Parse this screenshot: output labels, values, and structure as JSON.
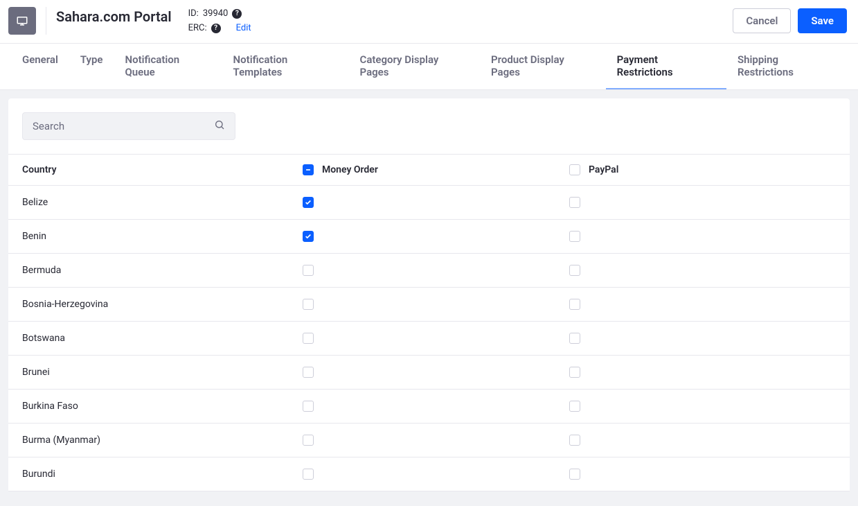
{
  "header": {
    "title": "Sahara.com Portal",
    "id_label": "ID:",
    "id_value": "39940",
    "erc_label": "ERC:",
    "edit": "Edit",
    "cancel": "Cancel",
    "save": "Save"
  },
  "tabs": [
    {
      "label": "General",
      "active": false
    },
    {
      "label": "Type",
      "active": false
    },
    {
      "label": "Notification Queue",
      "active": false
    },
    {
      "label": "Notification Templates",
      "active": false
    },
    {
      "label": "Category Display Pages",
      "active": false
    },
    {
      "label": "Product Display Pages",
      "active": false
    },
    {
      "label": "Payment Restrictions",
      "active": true
    },
    {
      "label": "Shipping Restrictions",
      "active": false
    }
  ],
  "search": {
    "placeholder": "Search"
  },
  "table": {
    "country_header": "Country",
    "columns": [
      {
        "label": "Money Order",
        "state": "indeterminate"
      },
      {
        "label": "PayPal",
        "state": "unchecked"
      }
    ],
    "rows": [
      {
        "country": "Belize",
        "cells": [
          "checked",
          "unchecked"
        ]
      },
      {
        "country": "Benin",
        "cells": [
          "checked",
          "unchecked"
        ]
      },
      {
        "country": "Bermuda",
        "cells": [
          "unchecked",
          "unchecked"
        ]
      },
      {
        "country": "Bosnia-Herzegovina",
        "cells": [
          "unchecked",
          "unchecked"
        ]
      },
      {
        "country": "Botswana",
        "cells": [
          "unchecked",
          "unchecked"
        ]
      },
      {
        "country": "Brunei",
        "cells": [
          "unchecked",
          "unchecked"
        ]
      },
      {
        "country": "Burkina Faso",
        "cells": [
          "unchecked",
          "unchecked"
        ]
      },
      {
        "country": "Burma (Myanmar)",
        "cells": [
          "unchecked",
          "unchecked"
        ]
      },
      {
        "country": "Burundi",
        "cells": [
          "unchecked",
          "unchecked"
        ]
      }
    ]
  }
}
